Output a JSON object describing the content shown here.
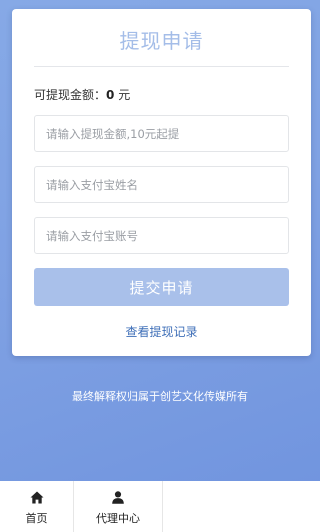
{
  "card": {
    "title": "提现申请",
    "balance_label": "可提现金额：",
    "balance_value": "0",
    "balance_unit": " 元"
  },
  "form": {
    "amount_placeholder": "请输入提现金额,10元起提",
    "name_placeholder": "请输入支付宝姓名",
    "account_placeholder": "请输入支付宝账号",
    "amount_value": "",
    "name_value": "",
    "account_value": "",
    "submit_label": "提交申请",
    "records_link": "查看提现记录"
  },
  "footer": {
    "note": "最终解释权归属于创艺文化传媒所有"
  },
  "tabbar": {
    "home": {
      "label": "首页",
      "icon": "home-icon"
    },
    "agent": {
      "label": "代理中心",
      "icon": "user-icon"
    }
  },
  "colors": {
    "background_gradient_start": "#86a9e6",
    "background_gradient_end": "#6f93de",
    "title": "#a4bde8",
    "button": "#a9c0ea",
    "link": "#3f6fb8"
  }
}
